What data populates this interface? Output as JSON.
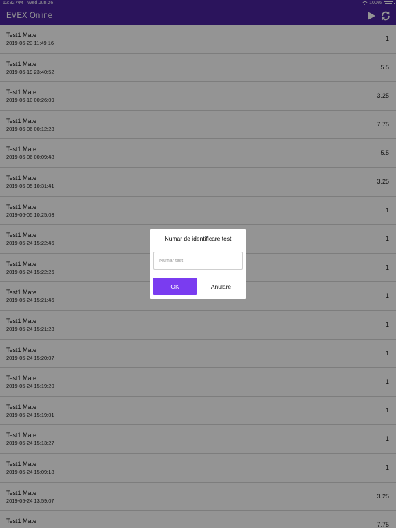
{
  "status_bar": {
    "time": "12:32 AM",
    "date": "Wed Jun 26",
    "battery": "100%"
  },
  "app_bar": {
    "title": "EVEX Online",
    "background_color": "#4a239f"
  },
  "tests": [
    {
      "title": "Test1 Mate",
      "date": "2019-06-23 11:49:16",
      "score": "1"
    },
    {
      "title": "Test1 Mate",
      "date": "2019-06-19 23:40:52",
      "score": "5.5"
    },
    {
      "title": "Test1 Mate",
      "date": "2019-06-10 00:26:09",
      "score": "3.25"
    },
    {
      "title": "Test1 Mate",
      "date": "2019-06-06 00:12:23",
      "score": "7.75"
    },
    {
      "title": "Test1 Mate",
      "date": "2019-06-06 00:09:48",
      "score": "5.5"
    },
    {
      "title": "Test1 Mate",
      "date": "2019-06-05 10:31:41",
      "score": "3.25"
    },
    {
      "title": "Test1 Mate",
      "date": "2019-06-05 10:25:03",
      "score": "1"
    },
    {
      "title": "Test1 Mate",
      "date": "2019-05-24 15:22:46",
      "score": "1"
    },
    {
      "title": "Test1 Mate",
      "date": "2019-05-24 15:22:26",
      "score": "1"
    },
    {
      "title": "Test1 Mate",
      "date": "2019-05-24 15:21:46",
      "score": "1"
    },
    {
      "title": "Test1 Mate",
      "date": "2019-05-24 15:21:23",
      "score": "1"
    },
    {
      "title": "Test1 Mate",
      "date": "2019-05-24 15:20:07",
      "score": "1"
    },
    {
      "title": "Test1 Mate",
      "date": "2019-05-24 15:19:20",
      "score": "1"
    },
    {
      "title": "Test1 Mate",
      "date": "2019-05-24 15:19:01",
      "score": "1"
    },
    {
      "title": "Test1 Mate",
      "date": "2019-05-24 15:13:27",
      "score": "1"
    },
    {
      "title": "Test1 Mate",
      "date": "2019-05-24 15:09:18",
      "score": "1"
    },
    {
      "title": "Test1 Mate",
      "date": "2019-05-24 13:59:07",
      "score": "3.25"
    },
    {
      "title": "Test1 Mate",
      "date": "",
      "score": "7.75"
    }
  ],
  "dialog": {
    "title": "Numar de identificare test",
    "input_placeholder": "Numar test",
    "input_value": "",
    "ok_label": "OK",
    "cancel_label": "Anulare",
    "ok_color": "#7a3cf0"
  },
  "icons": {
    "play": "play-icon",
    "refresh": "refresh-icon",
    "wifi": "wifi-icon",
    "battery": "battery-icon"
  }
}
